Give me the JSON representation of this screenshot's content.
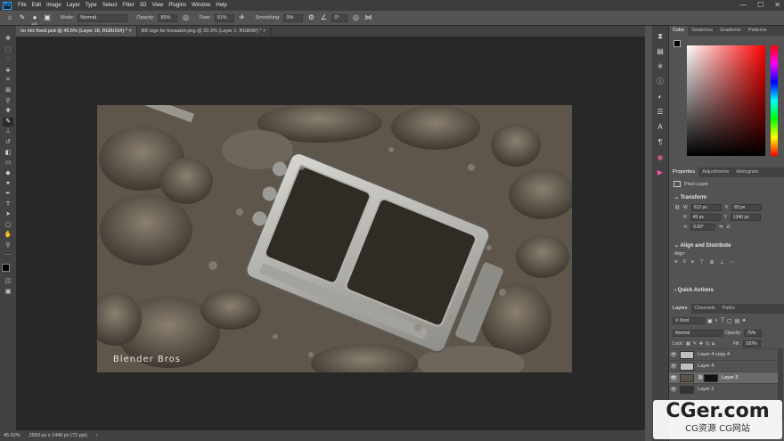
{
  "app": {
    "logo": "Ps"
  },
  "menu": [
    "File",
    "Edit",
    "Image",
    "Layer",
    "Type",
    "Select",
    "Filter",
    "3D",
    "View",
    "Plugins",
    "Window",
    "Help"
  ],
  "window_controls": [
    "—",
    "☐",
    "✕"
  ],
  "options": {
    "mode_label": "Mode:",
    "mode_value": "Normal",
    "opacity_label": "Opacity:",
    "opacity_value": "89%",
    "flow_label": "Flow:",
    "flow_value": "91%",
    "smoothing_label": "Smoothing:",
    "smoothing_value": "0%",
    "angle_value": "0°",
    "brush_size": "125"
  },
  "tabs": [
    {
      "label": "no mic fixed.psd @ 45.5% (Layer 18, RGB/16#) *",
      "close": "×"
    },
    {
      "label": "BB logo for breaakot.png @ 33.3% (Layer 1, RGB/8#) *",
      "close": "×"
    }
  ],
  "status": {
    "zoom": "45.52%",
    "doc_size": "2560 px x 1440 px (72 ppi)"
  },
  "canvas": {
    "watermark": "Blender Bros"
  },
  "color_panel": {
    "tabs": [
      "Color",
      "Swatches",
      "Gradients",
      "Patterns"
    ],
    "accent": "#ff0000"
  },
  "properties_panel": {
    "tabs": [
      "Properties",
      "Adjustments",
      "Histogram"
    ],
    "layer_kind": "Pixel Layer",
    "transform_title": "Transform",
    "w_label": "W",
    "w_value": "512 px",
    "h_label": "H",
    "h_value": "49 px",
    "x_label": "X",
    "x_value": "83 px",
    "y_label": "Y",
    "y_value": "1340 px",
    "rotation_value": "0.00°",
    "align_title": "Align and Distribute",
    "align_label": "Align:",
    "quick_actions_title": "Quick Actions"
  },
  "layers_panel": {
    "tabs": [
      "Layers",
      "Channels",
      "Paths"
    ],
    "filter_label": "Kind",
    "blend_mode": "Normal",
    "opacity_label": "Opacity:",
    "opacity_value": "75%",
    "lock_label": "Lock:",
    "fill_label": "Fill:",
    "fill_value": "100%",
    "layers": [
      {
        "name": "Layer 4 copy 4"
      },
      {
        "name": "Layer 4"
      },
      {
        "name": "Layer 3"
      },
      {
        "name": "Layer 2"
      }
    ]
  },
  "watermark_site": {
    "title": "CGer.com",
    "subtitle": "CG资源 CG网站"
  }
}
